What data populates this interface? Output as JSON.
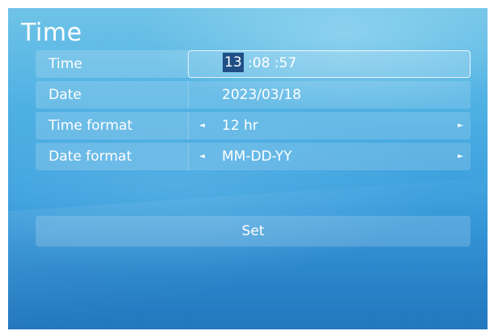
{
  "title": "Time",
  "rows": {
    "time": {
      "label": "Time",
      "hour": "13",
      "rest": " :08 :57"
    },
    "date": {
      "label": "Date",
      "value": "2023/03/18"
    },
    "time_format": {
      "label": "Time format",
      "value": "12 hr",
      "left_icon": "arrow-left-icon",
      "right_icon": "arrow-right-icon"
    },
    "date_format": {
      "label": "Date format",
      "value": "MM-DD-YY",
      "left_icon": "arrow-left-icon",
      "right_icon": "arrow-right-icon"
    }
  },
  "set_button": {
    "label": "Set"
  },
  "colors": {
    "background_top": "#6fc3e7",
    "background_bottom": "#2377bd",
    "highlight": "#1f4f86",
    "text": "#ffffff"
  }
}
